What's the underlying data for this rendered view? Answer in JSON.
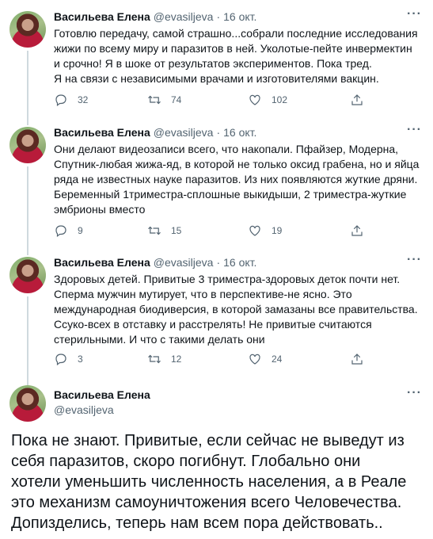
{
  "tweets": [
    {
      "name": "Васильева Елена",
      "handle": "@evasiljeva",
      "date": "16 окт.",
      "text": "Готовлю передачу, самой страшно...собрали последние исследования\nжижи по всему миру и паразитов в ней. Уколотые-пейте инвермектин\nи срочно! Я в шоке от результатов экспериментов. Пока тред.\nЯ на связи с независимыми врачами и изготовителями вакцин.",
      "replies": "32",
      "retweets": "74",
      "likes": "102"
    },
    {
      "name": "Васильева Елена",
      "handle": "@evasiljeva",
      "date": "16 окт.",
      "text": "Они делают видеозаписи всего, что накопали. Пфайзер, Модерна,\nСпутник-любая жижа-яд, в которой не только оксид грабена, но и яйца\nряда не известных науке паразитов. Из них появляются жуткие дряни.\nБеременный 1триместра-сплошные выкидыши, 2 триместра-жуткие\nэмбрионы вместо",
      "replies": "9",
      "retweets": "15",
      "likes": "19"
    },
    {
      "name": "Васильева Елена",
      "handle": "@evasiljeva",
      "date": "16 окт.",
      "text": "Здоровых детей. Привитые 3 триместра-здоровых деток почти нет.\nСперма мужчин мутирует, что в перспективе-не ясно. Это\nмеждународная биодиверсия, в которой замазаны все правительства.\nСсуко-всех в отставку и расстрелять! Не привитые считаются\nстерильными. И что с такими делать они",
      "replies": "3",
      "retweets": "12",
      "likes": "24"
    }
  ],
  "main_tweet": {
    "name": "Васильева Елена",
    "handle": "@evasiljeva",
    "text": "Пока не знают. Привитые, если сейчас не выведут из\nсебя паразитов, скоро погибнут. Глобально они\nхотели уменьшить численность населения, а в Реале\nэто механизм самоуничтожения всего Человечества.\nДопизделись, теперь нам всем пора действовать.."
  },
  "icons": {
    "more": "more-horizontal-icon",
    "reply": "reply-icon",
    "retweet": "retweet-icon",
    "like": "heart-icon",
    "share": "share-icon"
  },
  "colors": {
    "text": "#0f1419",
    "secondary": "#536471",
    "thread_line": "#cfd9de"
  }
}
